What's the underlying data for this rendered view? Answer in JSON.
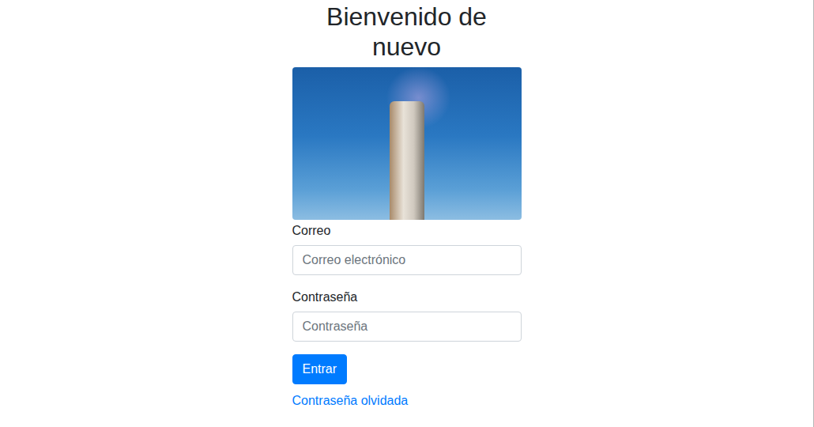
{
  "page": {
    "title": "Bienvenido de nuevo"
  },
  "fields": [
    {
      "label": "Correo",
      "placeholder": "Correo electrónico",
      "type": "email"
    },
    {
      "label": "Contraseña",
      "placeholder": "Contraseña",
      "type": "password"
    }
  ],
  "button": {
    "label": "Entrar"
  },
  "link": {
    "label": "Contraseña olvidada"
  }
}
